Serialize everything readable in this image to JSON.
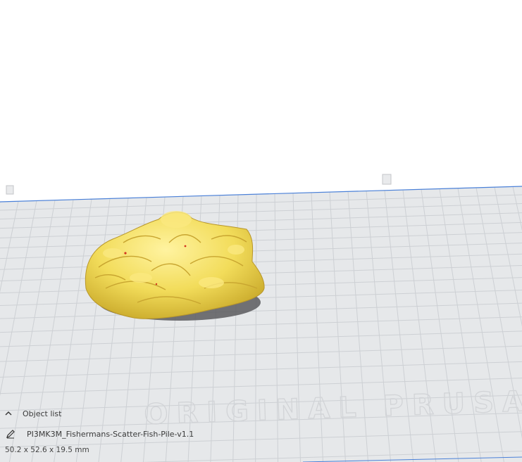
{
  "scene": {
    "bed_text": "ORIGINAL PRUSA",
    "model_color": "#f2dc5a",
    "bed_color": "#e6e8ea",
    "grid_color": "#c9ccd0",
    "edge_color": "#4a80d8"
  },
  "object_list": {
    "header_label": "Object list",
    "header_icon": "chevron-up-icon",
    "edit_icon": "pencil-icon",
    "object_name": "PI3MK3M_Fishermans-Scatter-Fish-Pile-v1.1",
    "dimensions": "50.2 x 52.6 x 19.5 mm"
  }
}
